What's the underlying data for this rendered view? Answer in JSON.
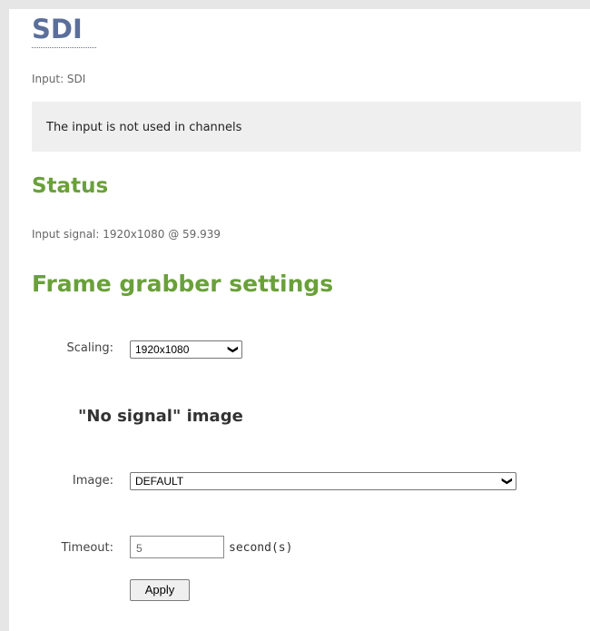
{
  "page": {
    "title": "SDI",
    "input_label": "Input: SDI"
  },
  "notice": {
    "text": "The input is not used in channels"
  },
  "status": {
    "heading": "Status",
    "signal_text": "Input signal: 1920x1080 @ 59.939"
  },
  "frame_grabber": {
    "heading": "Frame grabber settings",
    "scaling_label": "Scaling:",
    "scaling_value": "1920x1080",
    "no_signal_heading": "\"No signal\" image",
    "image_label": "Image:",
    "image_value": "DEFAULT",
    "timeout_label": "Timeout:",
    "timeout_value": "5",
    "timeout_unit": "second(s)",
    "apply_label": "Apply"
  },
  "icons": {
    "dropdown": "chevron-down-icon"
  },
  "colors": {
    "title": "#5a6f9a",
    "section_heading": "#6aa03a",
    "notice_bg": "#efefef"
  }
}
